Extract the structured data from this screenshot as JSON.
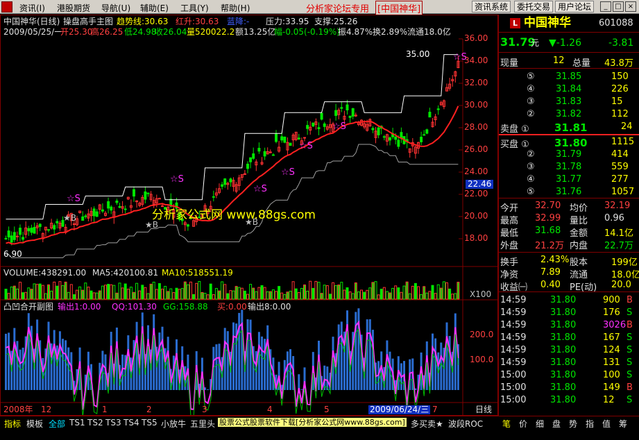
{
  "menubar": {
    "items": [
      "资讯(I)",
      "港股期货",
      "导航(U)",
      "辅助(E)",
      "工具(Y)",
      "帮助(H)"
    ],
    "banner": "分析家论坛专用",
    "banner2": "[中国神华]",
    "buttons": [
      "资讯系统",
      "委托交易",
      "用户论坛"
    ],
    "win_buttons": [
      "_",
      "□",
      "×"
    ]
  },
  "chart_header": {
    "title": "中国神华(日线)",
    "indicator": "操盘高手主图",
    "trend_label": "趋势线:30.63",
    "red_up": "红升:30.63",
    "blue_down": "蓝降:-",
    "pressure": "压力:33.95",
    "support": "支撑:25.26",
    "date_line": "2009/05/25/一",
    "open": "开25.30",
    "high": "高26.25",
    "low": "低24.98",
    "close": "收26.04",
    "volume": "量520022.2",
    "amount": "额13.25亿",
    "change": "幅-0.05(-0.19%)",
    "amplitude": "振4.87%",
    "turnover": "换2.89%",
    "float": "流通18.0亿"
  },
  "price_axis": [
    "36.00",
    "34.00",
    "32.00",
    "30.00",
    "28.00",
    "26.00",
    "24.00",
    "22.00",
    "20.00",
    "18.00"
  ],
  "price_marker": "22.46",
  "annotations": {
    "high_price": "35.00",
    "low_price": "6.90",
    "watermark": "分析家公式网 www.88gs.com",
    "s_marks": [
      "S",
      "S",
      "S",
      "S",
      "S",
      "S",
      "S",
      "S"
    ],
    "b_marks": [
      "B",
      "B",
      "B"
    ]
  },
  "volume_header": {
    "volume": "VOLUME:438291.00",
    "ma5": "MA5:420100.81",
    "ma10": "MA10:518551.19",
    "unit": "X100"
  },
  "sub_header": {
    "name": "凸凹合开副图",
    "out1": "输出1:0.00",
    "qq": "QQ:101.30",
    "gg": "GG:158.88",
    "buy": "买:0.00",
    "out8": "输出8:0.00"
  },
  "sub_axis": [
    "200.0",
    "100.0"
  ],
  "time_axis": {
    "labels": [
      "2008年",
      "12",
      "1",
      "2",
      "3",
      "4",
      "5",
      "6",
      "7"
    ],
    "cursor_date": "2009/06/24/三",
    "period": "日线"
  },
  "colors": {
    "bar_up": "#ff3232",
    "bar_down": "#00e600",
    "ma_red": "#ff2020",
    "trend_white": "#ffffff",
    "volume_blue": "#2a6cd0",
    "magenta": "#ff30ff"
  },
  "quote": {
    "logo": "L",
    "name": "中国神华",
    "code": "601088",
    "price": "31.79",
    "price_unit": "元",
    "change": "▼-1.26",
    "change_abs": "-3.81",
    "now_label": "现量",
    "now_val": "12",
    "total_label": "总量",
    "total_val": "43.8万",
    "sell": [
      {
        "label": "⑤",
        "price": "31.85",
        "vol": "150"
      },
      {
        "label": "④",
        "price": "31.84",
        "vol": "226"
      },
      {
        "label": "③",
        "price": "31.83",
        "vol": "15"
      },
      {
        "label": "②",
        "price": "31.82",
        "vol": "112"
      },
      {
        "label": "卖盘 ①",
        "price": "31.81",
        "vol": "24"
      }
    ],
    "buy": [
      {
        "label": "买盘 ①",
        "price": "31.80",
        "vol": "1115"
      },
      {
        "label": "②",
        "price": "31.79",
        "vol": "414"
      },
      {
        "label": "③",
        "price": "31.78",
        "vol": "559"
      },
      {
        "label": "④",
        "price": "31.77",
        "vol": "277"
      },
      {
        "label": "⑤",
        "price": "31.76",
        "vol": "1057"
      }
    ],
    "stats": [
      {
        "l1": "今开",
        "v1": "32.70",
        "l2": "均价",
        "v2": "32.19"
      },
      {
        "l1": "最高",
        "v1": "32.99",
        "l2": "量比",
        "v2": "0.96"
      },
      {
        "l1": "最低",
        "v1": "31.68",
        "l2": "金额",
        "v2": "14.1亿"
      },
      {
        "l1": "外盘",
        "v1": "21.2万",
        "l2": "内盘",
        "v2": "22.7万"
      }
    ],
    "stats2": [
      {
        "l1": "换手",
        "v1": "2.43%",
        "l2": "股本",
        "v2": "199亿"
      },
      {
        "l1": "净资",
        "v1": "7.89",
        "l2": "流通",
        "v2": "18.0亿"
      },
      {
        "l1": "收益㈠",
        "v1": "0.40",
        "l2": "PE(动)",
        "v2": "20.0"
      }
    ],
    "ticks": [
      {
        "time": "14:59",
        "price": "31.80",
        "vol": "900",
        "side": "B"
      },
      {
        "time": "14:59",
        "price": "31.80",
        "vol": "176",
        "side": "S"
      },
      {
        "time": "14:59",
        "price": "31.80",
        "vol": "3026",
        "side": "B"
      },
      {
        "time": "14:59",
        "price": "31.80",
        "vol": "167",
        "side": "S"
      },
      {
        "time": "14:59",
        "price": "31.80",
        "vol": "124",
        "side": "S"
      },
      {
        "time": "14:59",
        "price": "31.80",
        "vol": "131",
        "side": "S"
      },
      {
        "time": "15:00",
        "price": "31.80",
        "vol": "100",
        "side": "S"
      },
      {
        "time": "15:00",
        "price": "31.80",
        "vol": "149",
        "side": "B"
      },
      {
        "time": "15:00",
        "price": "31.80",
        "vol": "12",
        "side": "S"
      }
    ]
  },
  "bottom_tabs": [
    "指标",
    "模板",
    "全部",
    "TS1",
    "TS2",
    "TS3",
    "TS4",
    "TS5",
    "小放牛",
    "五里头",
    "多买卖★",
    "波段ROC"
  ],
  "status_text": "股票公式股票软件下载[分析家公式网www.88gs.com]",
  "right_tabs": [
    "笔",
    "价",
    "细",
    "盘",
    "势",
    "指",
    "值",
    "筹"
  ]
}
